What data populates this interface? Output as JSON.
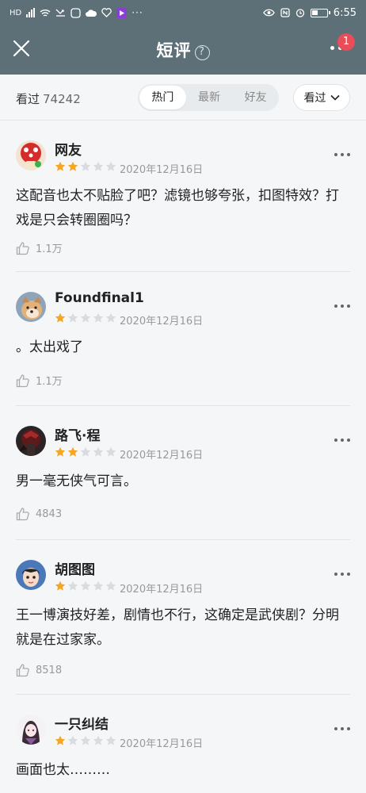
{
  "status_bar": {
    "left_text": "HD",
    "time": "6:55"
  },
  "header": {
    "title": "短评",
    "help_glyph": "?",
    "notification_count": "1"
  },
  "filter": {
    "watched_label": "看过",
    "watched_count": "74242",
    "tabs": [
      {
        "label": "热门"
      },
      {
        "label": "最新"
      },
      {
        "label": "好友"
      }
    ],
    "sort_label": "看过"
  },
  "reviews": [
    {
      "name": "网友",
      "rating": 2,
      "date": "2020年12月16日",
      "text": "这配音也太不贴脸了吧？滤镜也够夸张，扣图特效？打戏是只会转圈圈吗？",
      "likes": "1.1万"
    },
    {
      "name": "Foundfinal1",
      "rating": 1,
      "date": "2020年12月16日",
      "text": "。太出戏了",
      "likes": "1.1万"
    },
    {
      "name": "路飞·程",
      "rating": 2,
      "date": "2020年12月16日",
      "text": "男一毫无侠气可言。",
      "likes": "4843"
    },
    {
      "name": "胡图图",
      "rating": 1,
      "date": "2020年12月16日",
      "text": "王一博演技好差，剧情也不行，这确定是武侠剧？分明就是在过家家。",
      "likes": "8518"
    },
    {
      "name": "一只纠结",
      "rating": 1,
      "date": "2020年12月16日",
      "text": "画面也太………",
      "likes": ""
    }
  ],
  "colors": {
    "header_bg": "#5d6f77",
    "star_on": "#f5a623",
    "star_off": "#d8dcdf",
    "badge": "#e94d5a"
  }
}
